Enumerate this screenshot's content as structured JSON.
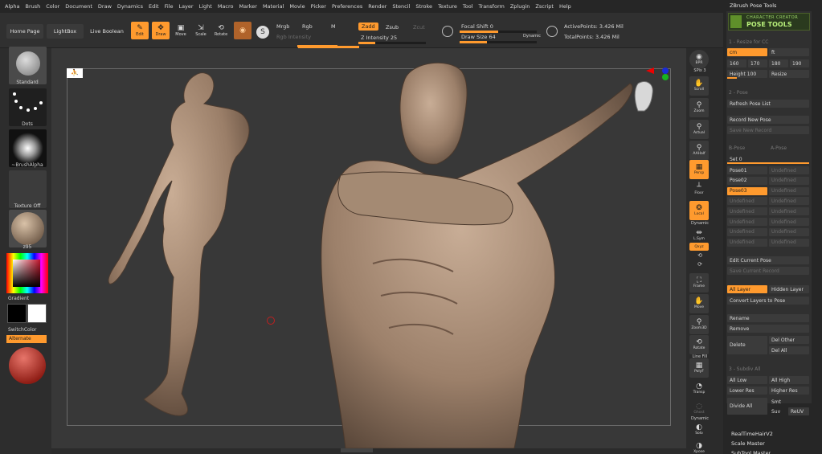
{
  "menu": [
    "Alpha",
    "Brush",
    "Color",
    "Document",
    "Draw",
    "Dynamics",
    "Edit",
    "File",
    "Layer",
    "Light",
    "Macro",
    "Marker",
    "Material",
    "Movie",
    "Picker",
    "Preferences",
    "Render",
    "Stencil",
    "Stroke",
    "Texture",
    "Tool",
    "Transform",
    "Zplugin",
    "Zscript",
    "Help"
  ],
  "toolbar": {
    "home_page": "Home Page",
    "lightbox": "LightBox",
    "live_boolean": "Live Boolean",
    "edit": "Edit",
    "draw": "Draw",
    "move": "Move",
    "scale": "Scale",
    "rotate": "Rotate",
    "mrgb": "Mrgb",
    "rgb": "Rgb",
    "m": "M",
    "rgb_intensity": "Rgb Intensity",
    "zadd": "Zadd",
    "zsub": "Zsub",
    "zcut": "Zcut",
    "z_intensity_label": "Z Intensity",
    "z_intensity_value": "25",
    "focal_shift_label": "Focal Shift",
    "focal_shift_value": "0",
    "draw_size_label": "Draw Size",
    "draw_size_value": "64",
    "dynamic": "Dynamic",
    "active_points": "ActivePoints: 3.426 Mil",
    "total_points": "TotalPoints: 3.426 Mil",
    "z_intensity_level": 0.25,
    "draw_size_level": 0.35
  },
  "left_tray": {
    "brush": "Standard",
    "stroke": "Dots",
    "alpha": "~BrushAlpha",
    "texture": "Texture Off",
    "material": "z95",
    "gradient": "Gradient",
    "switch_color": "SwitchColor",
    "alternate": "Alternate"
  },
  "right_icons": {
    "bpr": "BPR",
    "spix": "SPix 3",
    "scroll": "Scroll",
    "zoom": "Zoom",
    "actual": "Actual",
    "aahalf": "AAHalf",
    "persp": "Persp",
    "floor": "Floor",
    "local": "Local",
    "dynamic": "Dynamic",
    "lsym": "L.Sym",
    "xyz": "Qxyz",
    "frame": "Frame",
    "move": "Move",
    "zoom3d": "Zoom3D",
    "rotate": "Rotate",
    "line_fill": "Line Fill",
    "polyf": "PolyF",
    "transp": "Transp",
    "ghost": "Ghost",
    "dynamic2": "Dynamic",
    "solo": "Solo",
    "xpose": "Xpose"
  },
  "panel": {
    "title": "ZBrush Pose Tools",
    "logo_line1": "CHARACTER CREATOR",
    "logo_line2": "POSE TOOLS",
    "sec1": "1 - Resize for CC",
    "unit_cm": "cm",
    "unit_ft": "ft",
    "sizes": [
      "160",
      "170",
      "180",
      "190"
    ],
    "height_label": "Height",
    "height_value": "100",
    "resize": "Resize",
    "sec2": "2 - Pose",
    "refresh": "Refresh Pose List",
    "record_new": "Record New Pose",
    "save_new": "Save New Record",
    "b_pose": "B-Pose",
    "a_pose": "A-Pose",
    "set_label": "Set",
    "set_value": "0",
    "poses": [
      {
        "left": "Pose01",
        "right": "Undefined"
      },
      {
        "left": "Pose02",
        "right": "Undefined"
      },
      {
        "left": "Pose03",
        "right": "Undefined"
      },
      {
        "left": "Undefined",
        "right": "Undefined"
      },
      {
        "left": "Undefined",
        "right": "Undefined"
      },
      {
        "left": "Undefined",
        "right": "Undefined"
      },
      {
        "left": "Undefined",
        "right": "Undefined"
      },
      {
        "left": "Undefined",
        "right": "Undefined"
      }
    ],
    "edit_current": "Edit Current Pose",
    "save_current": "Save Current Record",
    "all_layer": "All Layer",
    "hidden_layer": "Hidden Layer",
    "convert_layers": "Convert Layers to Pose",
    "rename": "Rename",
    "remove": "Remove",
    "delete": "Delete",
    "del_other": "Del Other",
    "del_all": "Del All",
    "sec3": "3 - Subdiv All",
    "all_low": "All Low",
    "all_high": "All High",
    "lower_res": "Lower Res",
    "higher_res": "Higher Res",
    "divide_all": "Divide All",
    "smt": "Smt",
    "suv": "Suv",
    "reuv": "ReUV",
    "plugin1": "RealTimeHairV2",
    "plugin2": "Scale Master",
    "plugin3": "SubTool Master"
  },
  "colors": {
    "accent": "#ff9a2e",
    "clay": "#a08672",
    "bg": "#2b2b2b"
  }
}
